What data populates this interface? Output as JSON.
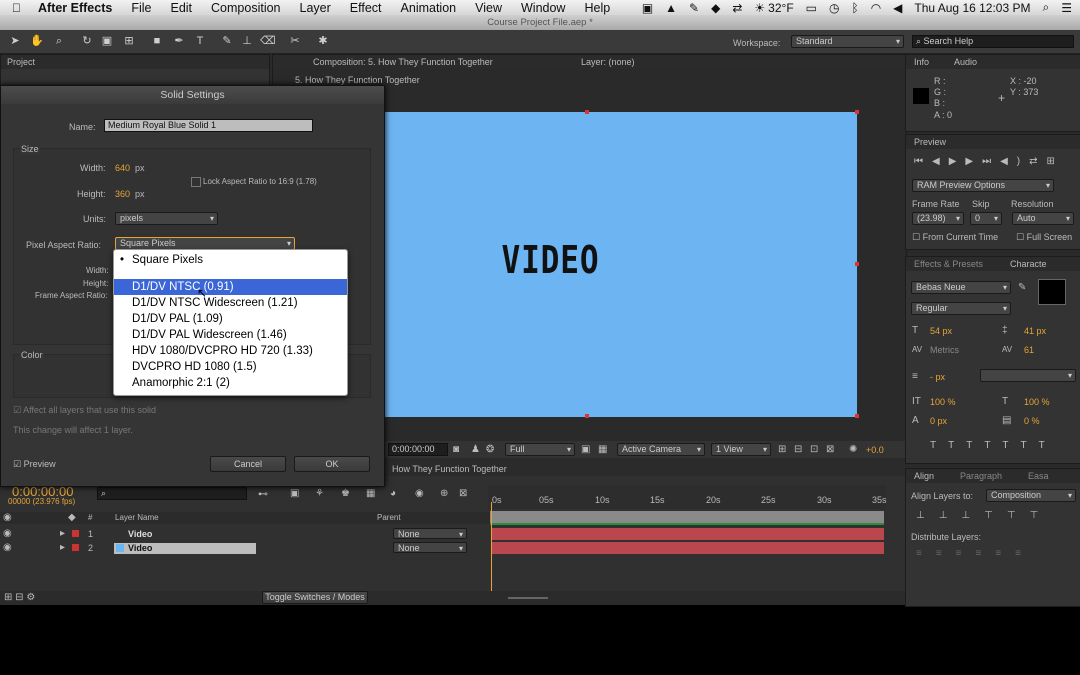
{
  "menubar": {
    "app": "After Effects",
    "items": [
      "File",
      "Edit",
      "Composition",
      "Layer",
      "Effect",
      "Animation",
      "View",
      "Window",
      "Help"
    ],
    "temp": "32°F",
    "datetime": "Thu Aug 16  12:03 PM"
  },
  "window": {
    "title": "Course Project File.aep *"
  },
  "toolbar": {
    "workspace_label": "Workspace:",
    "workspace_value": "Standard",
    "search_placeholder": "Search Help"
  },
  "project": {
    "tab": "Project"
  },
  "composition": {
    "tab": "Composition: 5. How They Function Together",
    "layer_tab": "Layer: (none)",
    "subtab": "5. How They Function Together",
    "video_text": "VIDEO",
    "solid_color": "#6cb4f2"
  },
  "dialog": {
    "title": "Solid Settings",
    "name_label": "Name:",
    "name_value": "Medium Royal Blue Solid 1",
    "size_label": "Size",
    "width_label": "Width:",
    "width_value": "640",
    "height_label": "Height:",
    "height_value": "360",
    "px": "px",
    "lock_label": "Lock Aspect Ratio to 16:9 (1.78)",
    "units_label": "Units:",
    "units_value": "pixels",
    "par_label": "Pixel Aspect Ratio:",
    "par_value": "Square Pixels",
    "sub_width": "Width:",
    "sub_height": "Height:",
    "frame_ar": "Frame Aspect Ratio:",
    "color_label": "Color",
    "affect_label": "Affect all layers that use this solid",
    "change_note": "This change will affect 1 layer.",
    "preview_label": "Preview",
    "cancel": "Cancel",
    "ok": "OK"
  },
  "par_options": [
    "Square Pixels",
    "D1/DV NTSC (0.91)",
    "D1/DV NTSC Widescreen (1.21)",
    "D1/DV PAL (1.09)",
    "D1/DV PAL Widescreen (1.46)",
    "HDV 1080/DVCPRO HD 720 (1.33)",
    "DVCPRO HD 1080 (1.5)",
    "Anamorphic 2:1 (2)"
  ],
  "viewer_bar": {
    "timecode": "0:00:00:00",
    "resolution": "Full",
    "camera": "Active Camera",
    "view": "1 View",
    "exposure": "+0.0"
  },
  "timeline": {
    "tab": "How They Function Together",
    "timecode": "0:00:00:00",
    "fps": "00000 (23.976 fps)",
    "col_layer": "Layer Name",
    "col_parent": "Parent",
    "ruler": [
      "0s",
      "05s",
      "10s",
      "15s",
      "20s",
      "25s",
      "30s",
      "35s"
    ],
    "layers": [
      {
        "num": "1",
        "name": "Video",
        "parent": "None"
      },
      {
        "num": "2",
        "name": "Video",
        "parent": "None"
      }
    ],
    "toggle": "Toggle Switches / Modes"
  },
  "info": {
    "tab": "Info",
    "tab2": "Audio",
    "r": "R :",
    "g": "G :",
    "b": "B :",
    "a": "A : 0",
    "x": "X : -20",
    "y": "Y : 373"
  },
  "preview": {
    "tab": "Preview",
    "ram": "RAM Preview Options",
    "frame_rate": "Frame Rate",
    "skip": "Skip",
    "resolution": "Resolution",
    "fr_value": "(23.98)",
    "skip_value": "0",
    "res_value": "Auto",
    "from_current": "From Current Time",
    "full_screen": "Full Screen"
  },
  "character": {
    "tab1": "Effects & Presets",
    "tab2": "Characte",
    "font": "Bebas Neue",
    "style": "Regular",
    "size": "54 px",
    "leading": "41 px",
    "kerning": "Metrics",
    "tracking": "61",
    "stroke": "- px",
    "vscale": "100 %",
    "hscale": "100 %",
    "baseline": "0 px",
    "tsume": "0 %"
  },
  "align": {
    "tab1": "Align",
    "tab2": "Paragraph",
    "tab3": "Easa",
    "align_to": "Align Layers to:",
    "align_value": "Composition",
    "distribute": "Distribute Layers:"
  }
}
